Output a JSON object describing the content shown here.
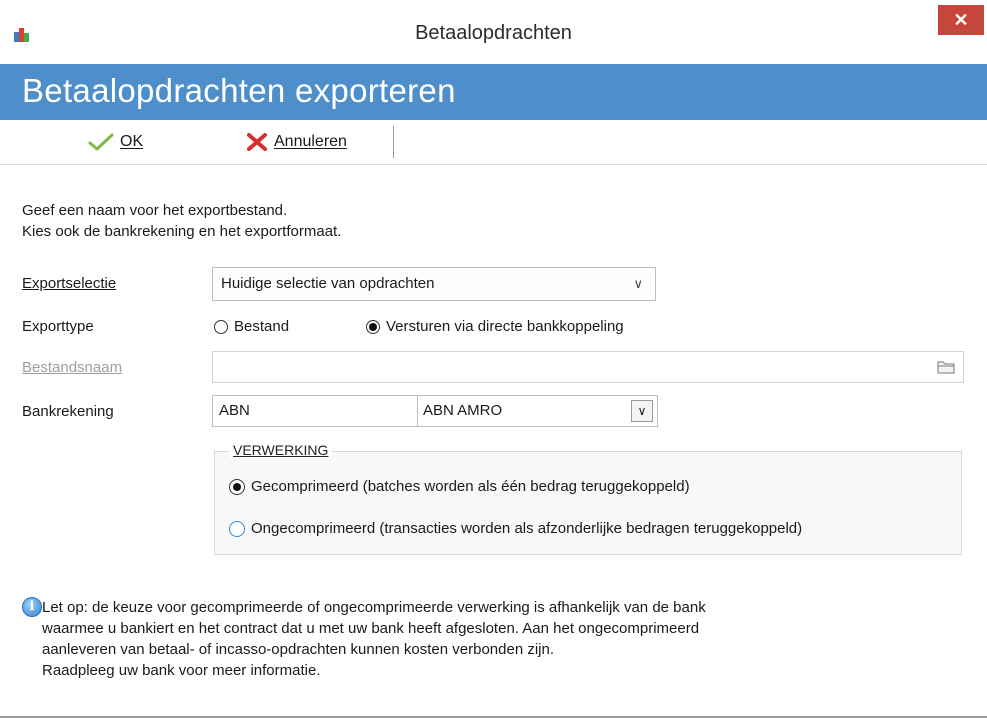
{
  "window": {
    "title": "Betaalopdrachten",
    "close_glyph": "✕"
  },
  "banner": {
    "title": "Betaalopdrachten exporteren"
  },
  "toolbar": {
    "ok_label": "OK",
    "ok_icon": "checkmark-icon",
    "cancel_label": "Annuleren",
    "cancel_icon": "red-x-icon"
  },
  "instructions": {
    "line1": "Geef een naam voor het exportbestand.",
    "line2": "Kies ook de bankrekening en het exportformaat."
  },
  "form": {
    "exportselectie_label": "Exportselectie",
    "exportselectie_value": "Huidige selectie van opdrachten",
    "exporttype_label": "Exporttype",
    "exporttype_options": [
      "Bestand",
      "Versturen via directe bankkoppeling"
    ],
    "exporttype_selected": "Versturen via directe bankkoppeling",
    "bestandsnaam_label": "Bestandsnaam",
    "bestandsnaam_value": "",
    "bankrekening_label": "Bankrekening",
    "bank_code": "ABN",
    "bank_name": "ABN AMRO"
  },
  "verwerking": {
    "legend": "VERWERKING",
    "options": [
      "Gecomprimeerd (batches worden als één bedrag teruggekoppeld)",
      "Ongecomprimeerd (transacties worden als afzonderlijke bedragen teruggekoppeld)"
    ],
    "selected": "Gecomprimeerd (batches worden als één bedrag teruggekoppeld)"
  },
  "note": {
    "line1": "Let op: de keuze voor gecomprimeerde of ongecomprimeerde verwerking is afhankelijk van de bank",
    "line2": "waarmee u bankiert en het contract dat u met uw bank heeft afgesloten. Aan het ongecomprimeerd",
    "line3": "aanleveren van betaal- of incasso-opdrachten kunnen kosten verbonden zijn.",
    "line4": "Raadpleeg uw bank voor meer informatie."
  },
  "colors": {
    "banner": "#4e8fcb",
    "close_button": "#c7463c",
    "radio_accent": "#3a86d4"
  }
}
